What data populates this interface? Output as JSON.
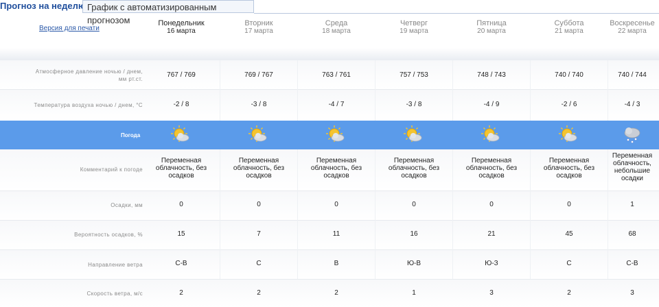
{
  "tabs": {
    "active": "Прогноз на неделю",
    "other": "График с автоматизированным прогнозом"
  },
  "print_link": "Версия для печати",
  "days": [
    {
      "name": "Понедельник",
      "date": "16 марта",
      "today": true
    },
    {
      "name": "Вторник",
      "date": "17 марта"
    },
    {
      "name": "Среда",
      "date": "18 марта"
    },
    {
      "name": "Четверг",
      "date": "19 марта"
    },
    {
      "name": "Пятница",
      "date": "20 марта"
    },
    {
      "name": "Суббота",
      "date": "21 марта"
    },
    {
      "name": "Воскресенье",
      "date": "22 марта"
    }
  ],
  "rows": {
    "pressure": {
      "label_line1": "Атмосферное давление ночью / днем,",
      "label_line2": "мм рт.ст.",
      "values": [
        "767 / 769",
        "769 / 767",
        "763 / 761",
        "757 / 753",
        "748 / 743",
        "740 / 740",
        "740 / 744"
      ]
    },
    "temperature": {
      "label": "Температура воздуха ночью / днем, °С",
      "values": [
        "-2 / 8",
        "-3 / 8",
        "-4 / 7",
        "-3 / 8",
        "-4 / 9",
        "-2 / 6",
        "-4 / 3"
      ]
    },
    "weather": {
      "label": "Погода",
      "icons": [
        "sun-cloud-icon",
        "sun-cloud-icon",
        "sun-cloud-icon",
        "sun-cloud-icon",
        "sun-cloud-icon",
        "sun-cloud-icon",
        "cloud-light-snow-icon"
      ]
    },
    "comment": {
      "label": "Комментарий к погоде",
      "values": [
        [
          "Переменная",
          "облачность, без",
          "осадков"
        ],
        [
          "Переменная",
          "облачность, без",
          "осадков"
        ],
        [
          "Переменная",
          "облачность, без",
          "осадков"
        ],
        [
          "Переменная",
          "облачность, без",
          "осадков"
        ],
        [
          "Переменная",
          "облачность, без",
          "осадков"
        ],
        [
          "Переменная",
          "облачность, без",
          "осадков"
        ],
        [
          "Переменная",
          "облачность,",
          "небольшие",
          "осадки"
        ]
      ]
    },
    "precip": {
      "label": "Осадки, мм",
      "values": [
        "0",
        "0",
        "0",
        "0",
        "0",
        "0",
        "1"
      ]
    },
    "probability": {
      "label": "Вероятность осадков, %",
      "values": [
        "15",
        "7",
        "11",
        "16",
        "21",
        "45",
        "68"
      ]
    },
    "wind_dir": {
      "label": "Направление ветра",
      "values": [
        "С-В",
        "С",
        "В",
        "Ю-В",
        "Ю-З",
        "С",
        "С-В"
      ]
    },
    "wind_speed": {
      "label": "Скорость ветра, м/с",
      "values": [
        "2",
        "2",
        "2",
        "1",
        "3",
        "2",
        "3"
      ]
    }
  },
  "colors": {
    "band": "#5b9bea",
    "link": "#2a58a8",
    "tab_active": "#1f4e9c"
  }
}
